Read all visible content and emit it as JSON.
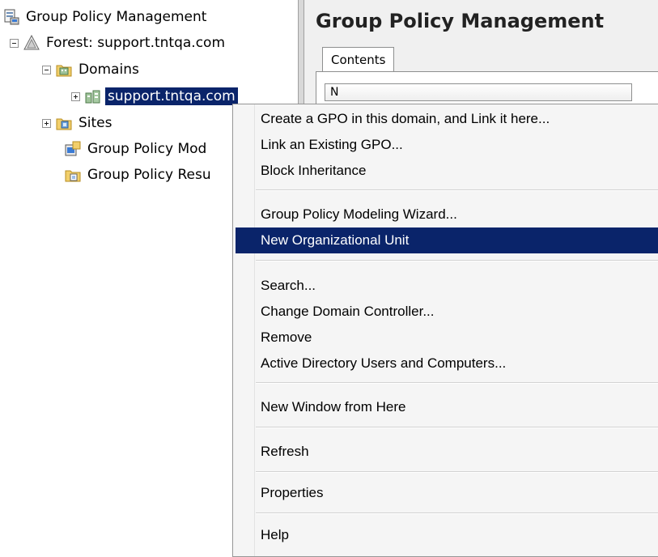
{
  "tree": {
    "root_label": "Group Policy Management",
    "forest_label": "Forest: support.tntqa.com",
    "domains_label": "Domains",
    "domain_item_label": "support.tntqa.com",
    "sites_label": "Sites",
    "modeling_label": "Group Policy Mod",
    "results_label": "Group Policy Resu"
  },
  "right_pane": {
    "title": "Group Policy Management",
    "tab_label": "Contents",
    "column_header": "N"
  },
  "context_menu": {
    "items": [
      "Create a GPO in this domain, and Link it here...",
      "Link an Existing GPO...",
      "Block Inheritance",
      "Group Policy Modeling Wizard...",
      "New Organizational Unit",
      "Search...",
      "Change Domain Controller...",
      "Remove",
      "Active Directory Users and Computers...",
      "New Window from Here",
      "Refresh",
      "Properties",
      "Help"
    ],
    "highlighted_item": "New Organizational Unit"
  },
  "colors": {
    "selection": "#0a246a",
    "menu_background": "#f5f5f5",
    "pane_background": "#f0f0f0"
  }
}
